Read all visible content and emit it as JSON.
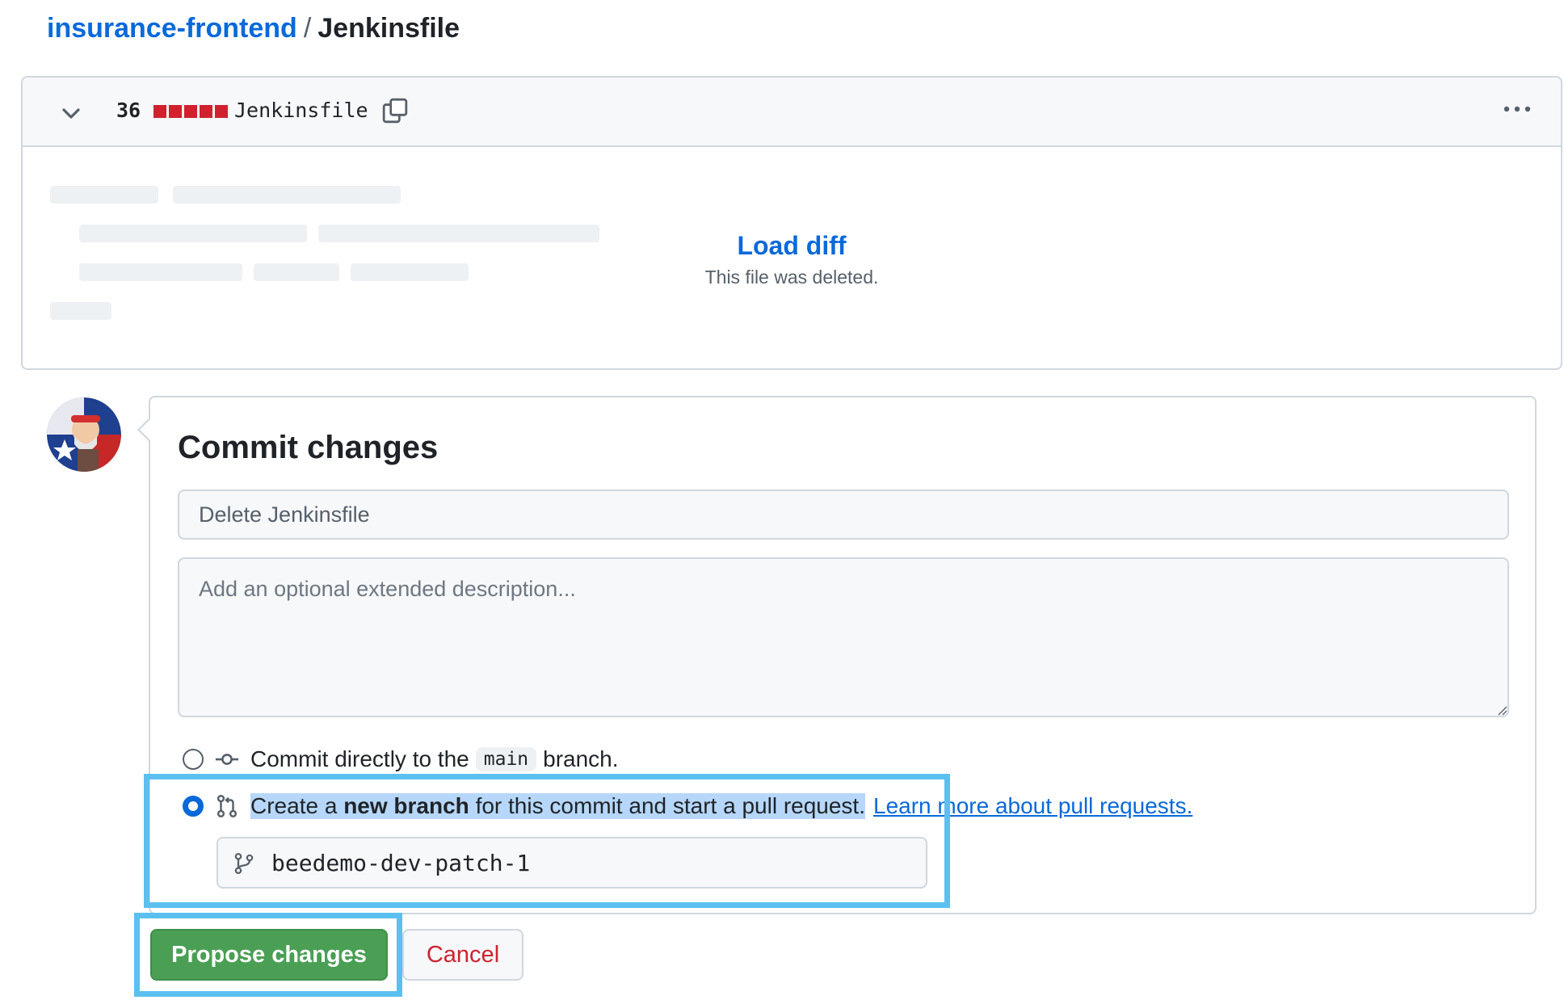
{
  "breadcrumb": {
    "repo": "insurance-frontend",
    "separator": "/",
    "file": "Jenkinsfile"
  },
  "diff": {
    "changes_count": "36",
    "diffstat": {
      "deleted_blocks": 5,
      "color": "#cf222e"
    },
    "filename": "Jenkinsfile",
    "load_diff_label": "Load diff",
    "note": "This file was deleted."
  },
  "commit": {
    "title": "Commit changes",
    "summary_placeholder": "Delete Jenkinsfile",
    "description_placeholder": "Add an optional extended description...",
    "options": {
      "direct": {
        "prefix": "Commit directly to the",
        "branch": "main",
        "suffix": "branch.",
        "selected": false
      },
      "new_branch": {
        "text_before": "Create a",
        "text_bold": "new branch",
        "text_after": "for this commit and start a pull request.",
        "link": "Learn more about pull requests.",
        "selected": true
      }
    },
    "branch_name": "beedemo-dev-patch-1"
  },
  "buttons": {
    "propose": "Propose changes",
    "cancel": "Cancel"
  },
  "icons": [
    "chevron-down-icon",
    "copy-icon",
    "kebab-horizontal-icon",
    "avatar",
    "git-commit-icon",
    "git-pull-request-icon",
    "git-branch-icon"
  ],
  "colors": {
    "link": "#0969da",
    "primary_button": "#4a9f55",
    "cancel_text": "#cf222e",
    "annotation_highlight": "#5bc0f0"
  }
}
